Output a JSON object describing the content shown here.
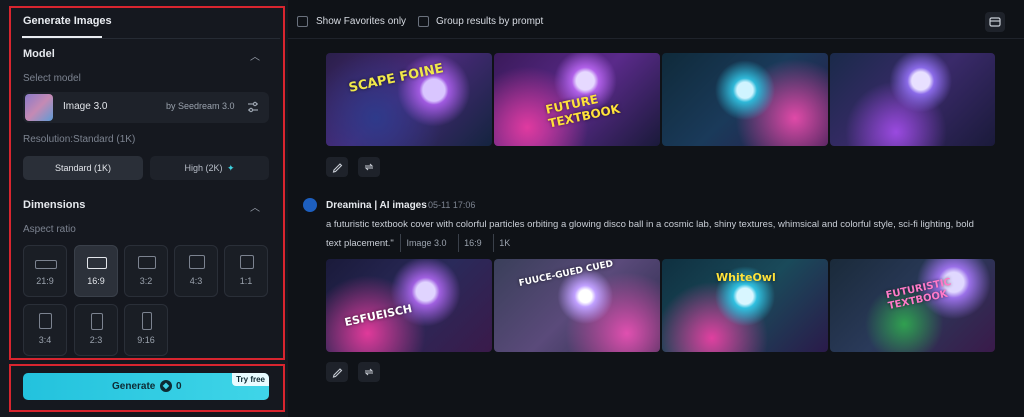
{
  "sidebar": {
    "tab": "Generate Images",
    "model_section": {
      "title": "Model",
      "select_label": "Select model"
    },
    "model": {
      "name": "Image 3.0",
      "by": "by Seedream 3.0"
    },
    "resolution": {
      "label": "Resolution:Standard (1K)",
      "standard": "Standard (1K)",
      "high": "High (2K)",
      "high_icon": "✦"
    },
    "dimensions": {
      "title": "Dimensions",
      "aspect_label": "Aspect ratio"
    },
    "ratios": [
      "21:9",
      "16:9",
      "3:2",
      "4:3",
      "1:1",
      "3:4",
      "2:3",
      "9:16"
    ],
    "selected_ratio": "16:9",
    "generate": {
      "label": "Generate",
      "coin": "◆",
      "cost": "0",
      "badge": "Try free"
    }
  },
  "toolbar": {
    "show_favorites": "Show Favorites only",
    "group_results": "Group results by prompt"
  },
  "result": {
    "author": "Dreamina | AI images",
    "date": "05-11  17:06",
    "prompt": "a futuristic textbook cover with colorful particles orbiting a glowing disco ball in a cosmic lab, shiny textures, whimsical and colorful style, sci-fi lighting, bold text placement.\"",
    "tags": [
      "Image 3.0",
      "16:9",
      "1K"
    ]
  },
  "images_row1": [
    {
      "text": "SCAPE FOINE",
      "text_color": "#f0e84a"
    },
    {
      "text": "FUTURE TEXTBOOK",
      "text_color": "#ffe23a"
    },
    {
      "text": "",
      "text_color": "#ffffff"
    },
    {
      "text": "",
      "text_color": "#ffffff"
    }
  ],
  "images_row2": [
    {
      "text": "ESFUEISCH",
      "text_color": "#ffffff"
    },
    {
      "text": "FUUCE-GUED CUED",
      "text_color": "#ffffff"
    },
    {
      "text": "WhiteOwl",
      "text_color": "#ffe23a"
    },
    {
      "text": "FUTURISTIC TEXTBOOK",
      "text_color": "#ff7ac8"
    }
  ],
  "colors": {
    "accent": "#3fd5e8",
    "highlight_border": "#d8252f"
  }
}
